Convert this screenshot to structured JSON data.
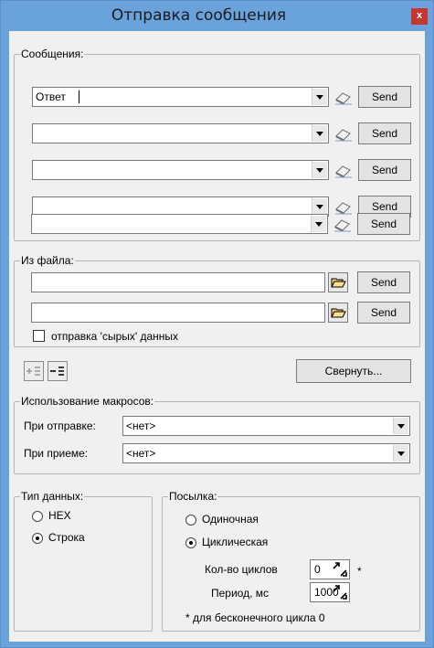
{
  "window": {
    "title": "Отправка сообщения",
    "close_label": "x"
  },
  "messages": {
    "legend": "Сообщения:",
    "rows": [
      {
        "value": "Ответ",
        "send_label": "Send"
      },
      {
        "value": "",
        "send_label": "Send"
      },
      {
        "value": "",
        "send_label": "Send"
      },
      {
        "value": "",
        "send_label": "Send"
      },
      {
        "value": "",
        "send_label": "Send"
      }
    ]
  },
  "from_file": {
    "legend": "Из файла:",
    "rows": [
      {
        "value": "",
        "send_label": "Send"
      },
      {
        "value": "",
        "send_label": "Send"
      }
    ],
    "raw_checkbox_label": "отправка 'сырых' данных",
    "raw_checked": false
  },
  "toolbar": {
    "add_icon": "add-row-icon",
    "remove_icon": "remove-row-icon",
    "collapse_label": "Свернуть..."
  },
  "macros": {
    "legend": "Использование макросов:",
    "on_send_label": "При отправке:",
    "on_send_value": "<нет>",
    "on_receive_label": "При приеме:",
    "on_receive_value": "<нет>"
  },
  "data_type": {
    "legend": "Тип данных:",
    "options": [
      {
        "label": "HEX",
        "selected": false
      },
      {
        "label": "Строка",
        "selected": true
      }
    ]
  },
  "sending": {
    "legend": "Посылка:",
    "options": [
      {
        "label": "Одиночная",
        "selected": false
      },
      {
        "label": "Циклическая",
        "selected": true
      }
    ],
    "cycles_label": "Кол-во циклов",
    "cycles_value": "0",
    "cycles_asterisk": "*",
    "period_label": "Период, мс",
    "period_value": "1000",
    "footnote": "* для бесконечного цикла  0"
  },
  "colors": {
    "frame": "#6aa2dc",
    "close": "#c7372f",
    "client": "#f0f0f0"
  }
}
